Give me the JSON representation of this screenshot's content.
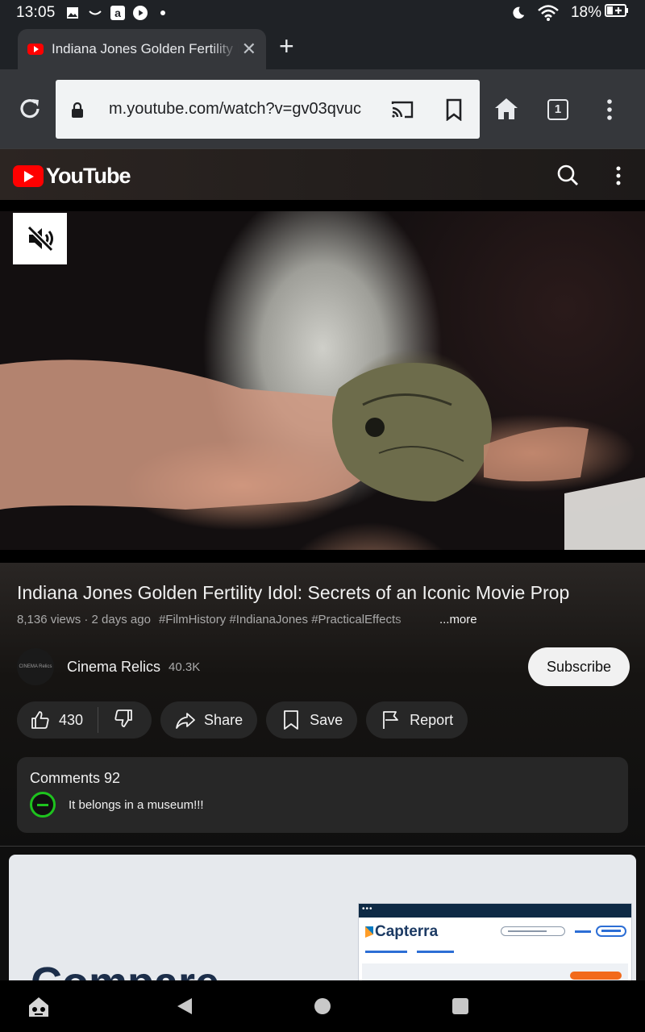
{
  "status_bar": {
    "time": "13:05",
    "battery": "18%",
    "icons": [
      "image-icon",
      "amazon-icon-shape",
      "amazon-icon",
      "youtube-play-icon",
      "dot-icon",
      "moon-icon",
      "wifi-icon",
      "battery-charging-icon"
    ]
  },
  "browser": {
    "tab_title": "Indiana Jones Golden Fertility Idol: Secrets of an Iconic Movie Prop",
    "url": "m.youtube.com/watch?v=gv03qvuc",
    "tab_count": "1"
  },
  "youtube": {
    "logo_text": "YouTube",
    "video": {
      "title": "Indiana Jones Golden Fertility Idol: Secrets of an Iconic Movie Prop",
      "views_date": "8,136 views · 2 days ago",
      "hashtags": "#FilmHistory #IndianaJones #PracticalEffects",
      "more_label": "...more"
    },
    "channel": {
      "avatar_text": "CINEMA Relics",
      "name": "Cinema Relics",
      "subscribers": "40.3K",
      "subscribe_label": "Subscribe"
    },
    "actions": {
      "likes": "430",
      "share_label": "Share",
      "save_label": "Save",
      "report_label": "Report"
    },
    "comments": {
      "title": "Comments 92",
      "top_comment": "It belongs in a museum!!!"
    }
  },
  "ad": {
    "headline": "Compare",
    "brand": "Capterra",
    "window_dots": "•••"
  },
  "colors": {
    "youtube_red": "#ff0000",
    "toolbar": "#35373b",
    "comment_avatar_green": "#1ec31e",
    "capterra_navy": "#1c3a63"
  }
}
